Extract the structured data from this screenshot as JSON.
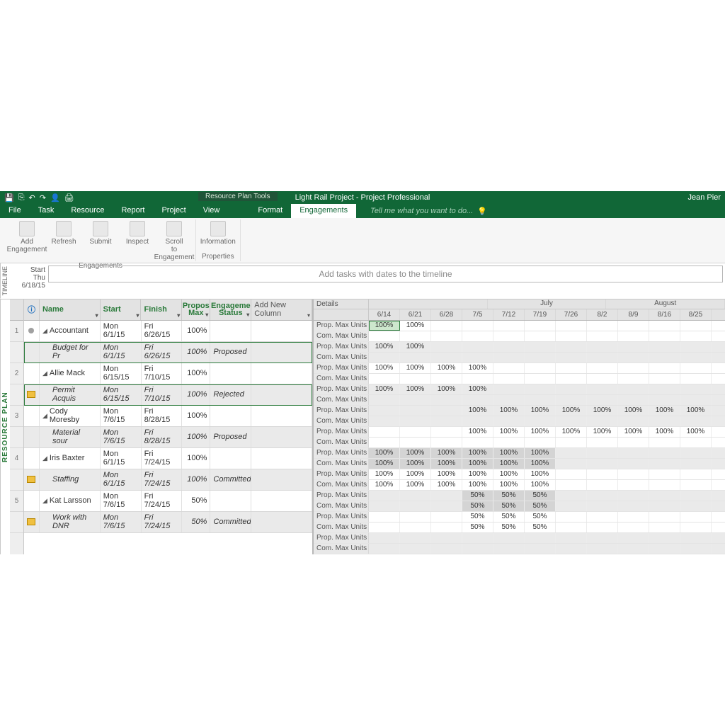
{
  "app_title": "Light Rail Project - Project Professional",
  "tool_tab": "Resource Plan Tools",
  "user_name": "Jean Pier",
  "quick_access": [
    "💾",
    "⎘",
    "↶",
    "↷",
    "👤",
    "🖨"
  ],
  "menu_tabs": [
    "File",
    "Task",
    "Resource",
    "Report",
    "Project",
    "View",
    "Format",
    "Engagements"
  ],
  "active_tab": "Engagements",
  "tellme_placeholder": "Tell me what you want to do...",
  "ribbon": {
    "groups": [
      {
        "label": "Engagements",
        "buttons": [
          {
            "label": "Add Engagement"
          },
          {
            "label": "Refresh"
          },
          {
            "label": "Submit"
          },
          {
            "label": "Inspect"
          },
          {
            "label": "Scroll to Engagement"
          }
        ]
      },
      {
        "label": "Properties",
        "buttons": [
          {
            "label": "Information"
          }
        ]
      }
    ]
  },
  "timeline": {
    "side_label": "TIMELINE",
    "start_label": "Start",
    "start_date": "Thu 6/18/15",
    "placeholder": "Add tasks with dates to the timeline"
  },
  "resource_plan_label": "RESOURCE PLAN",
  "columns": {
    "info_icon": "ⓘ",
    "name": "Name",
    "start": "Start",
    "finish": "Finish",
    "propmax_l1": "Propos",
    "propmax_l2": "Max",
    "status_l1": "Engageme",
    "status_l2": "Status",
    "addcol": "Add New Column"
  },
  "rows": [
    {
      "num": "1",
      "type": "parent",
      "icon": "bullet",
      "name": "Accountant",
      "start": "Mon 6/1/15",
      "finish": "Fri 6/26/15",
      "max": "100%",
      "status": ""
    },
    {
      "num": "",
      "type": "sub",
      "outlined": true,
      "icon": "",
      "name": "Budget for Pr",
      "start": "Mon 6/1/15",
      "finish": "Fri 6/26/15",
      "max": "100%",
      "status": "Proposed"
    },
    {
      "num": "2",
      "type": "parent",
      "tall": true,
      "icon": "",
      "name": "Allie Mack",
      "start": "Mon 6/15/15",
      "finish": "Fri 7/10/15",
      "max": "100%",
      "status": ""
    },
    {
      "num": "",
      "type": "sub",
      "outlined": true,
      "icon": "note",
      "name": "Permit Acquis",
      "start": "Mon 6/15/15",
      "finish": "Fri 7/10/15",
      "max": "100%",
      "status": "Rejected"
    },
    {
      "num": "3",
      "type": "parent",
      "icon": "",
      "name": "Cody Moresby",
      "start": "Mon 7/6/15",
      "finish": "Fri 8/28/15",
      "max": "100%",
      "status": ""
    },
    {
      "num": "",
      "type": "sub",
      "icon": "",
      "name": "Material sour",
      "start": "Mon 7/6/15",
      "finish": "Fri 8/28/15",
      "max": "100%",
      "status": "Proposed"
    },
    {
      "num": "4",
      "type": "parent",
      "icon": "",
      "name": "Iris Baxter",
      "start": "Mon 6/1/15",
      "finish": "Fri 7/24/15",
      "max": "100%",
      "status": ""
    },
    {
      "num": "",
      "type": "sub",
      "icon": "note",
      "name": "Staffing",
      "start": "Mon 6/1/15",
      "finish": "Fri 7/24/15",
      "max": "100%",
      "status": "Committed"
    },
    {
      "num": "5",
      "type": "parent",
      "icon": "",
      "name": "Kat Larsson",
      "start": "Mon 7/6/15",
      "finish": "Fri 7/24/15",
      "max": "50%",
      "status": ""
    },
    {
      "num": "",
      "type": "sub",
      "icon": "note",
      "name": "Work with DNR",
      "start": "Mon 7/6/15",
      "finish": "Fri 7/24/15",
      "max": "50%",
      "status": "Committed"
    }
  ],
  "timephased": {
    "details_label": "Details",
    "months": [
      {
        "label": "",
        "span": 2
      },
      {
        "label": "July",
        "span": 4
      },
      {
        "label": "August",
        "span": 5
      }
    ],
    "weeks": [
      "6/14",
      "6/21",
      "6/28",
      "7/5",
      "7/12",
      "7/19",
      "7/26",
      "8/2",
      "8/9",
      "8/16",
      "8/25"
    ],
    "row_labels": {
      "prop": "Prop. Max Units",
      "com": "Com. Max Units"
    },
    "data": [
      {
        "prop": [
          "100%",
          "100%",
          "",
          "",
          "",
          "",
          "",
          "",
          "",
          "",
          ""
        ],
        "com": [
          "",
          "",
          "",
          "",
          "",
          "",
          "",
          "",
          "",
          "",
          ""
        ],
        "sel_prop": 0
      },
      {
        "prop": [
          "100%",
          "100%",
          "",
          "",
          "",
          "",
          "",
          "",
          "",
          "",
          ""
        ],
        "com": [
          "",
          "",
          "",
          "",
          "",
          "",
          "",
          "",
          "",
          "",
          ""
        ],
        "alt": true
      },
      {
        "prop": [
          "100%",
          "100%",
          "100%",
          "100%",
          "",
          "",
          "",
          "",
          "",
          "",
          ""
        ],
        "com": [
          "",
          "",
          "",
          "",
          "",
          "",
          "",
          "",
          "",
          "",
          ""
        ]
      },
      {
        "prop": [
          "100%",
          "100%",
          "100%",
          "100%",
          "",
          "",
          "",
          "",
          "",
          "",
          ""
        ],
        "com": [
          "",
          "",
          "",
          "",
          "",
          "",
          "",
          "",
          "",
          "",
          ""
        ],
        "alt": true
      },
      {
        "prop": [
          "",
          "",
          "",
          "100%",
          "100%",
          "100%",
          "100%",
          "100%",
          "100%",
          "100%",
          "100%"
        ],
        "com": [
          "",
          "",
          "",
          "",
          "",
          "",
          "",
          "",
          "",
          "",
          ""
        ],
        "alt": true
      },
      {
        "prop": [
          "",
          "",
          "",
          "100%",
          "100%",
          "100%",
          "100%",
          "100%",
          "100%",
          "100%",
          "100%"
        ],
        "com": [
          "",
          "",
          "",
          "",
          "",
          "",
          "",
          "",
          "",
          "",
          ""
        ]
      },
      {
        "prop": [
          "100%",
          "100%",
          "100%",
          "100%",
          "100%",
          "100%",
          "",
          "",
          "",
          "",
          ""
        ],
        "com": [
          "100%",
          "100%",
          "100%",
          "100%",
          "100%",
          "100%",
          "",
          "",
          "",
          "",
          ""
        ],
        "filled": true,
        "alt": true
      },
      {
        "prop": [
          "100%",
          "100%",
          "100%",
          "100%",
          "100%",
          "100%",
          "",
          "",
          "",
          "",
          ""
        ],
        "com": [
          "100%",
          "100%",
          "100%",
          "100%",
          "100%",
          "100%",
          "",
          "",
          "",
          "",
          ""
        ]
      },
      {
        "prop": [
          "",
          "",
          "",
          "50%",
          "50%",
          "50%",
          "",
          "",
          "",
          "",
          ""
        ],
        "com": [
          "",
          "",
          "",
          "50%",
          "50%",
          "50%",
          "",
          "",
          "",
          "",
          ""
        ],
        "filled": true,
        "alt": true
      },
      {
        "prop": [
          "",
          "",
          "",
          "50%",
          "50%",
          "50%",
          "",
          "",
          "",
          "",
          ""
        ],
        "com": [
          "",
          "",
          "",
          "50%",
          "50%",
          "50%",
          "",
          "",
          "",
          "",
          ""
        ]
      },
      {
        "prop": [
          "",
          "",
          "",
          "",
          "",
          "",
          "",
          "",
          "",
          "",
          ""
        ],
        "com": [
          "",
          "",
          "",
          "",
          "",
          "",
          "",
          "",
          "",
          "",
          ""
        ],
        "alt": true
      }
    ]
  }
}
